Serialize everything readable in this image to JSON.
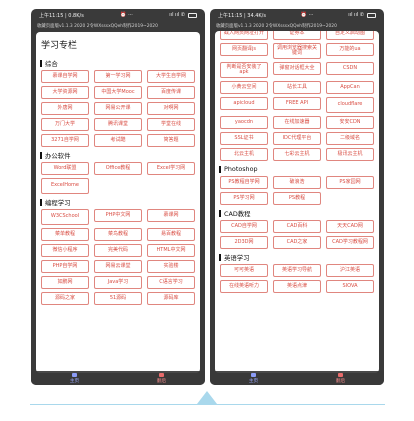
{
  "status": {
    "left": {
      "time_speed": "上午11:15 | 0.8K/s",
      "icons": "⏰ ···"
    },
    "right": {
      "time_speed": "上午11:15 | 34.4K/s",
      "icons": "⏰ ···"
    },
    "signal": "ııl ııl ✆"
  },
  "version_text": "收藏页面版v1.1.3 2020 2令WXsssxQQeh制作2019~2020",
  "left": {
    "card_title": "学习专栏",
    "sections": [
      {
        "title": "综合",
        "items": [
          "慕课自学网",
          "第一学习网",
          "大学生自学网",
          "大学资源网",
          "中国大学Mooc",
          "百度传课",
          "外唐网",
          "网易公开课",
          "对啊网",
          "万门大学",
          "腾讯课堂",
          "学堂在线",
          "3271自学网",
          "考试酷",
          "简答题"
        ]
      },
      {
        "title": "办公软件",
        "items": [
          "Word联盟",
          "Office教程",
          "Excel学习网",
          "ExcelHome"
        ]
      },
      {
        "title": "编程学习",
        "items": [
          "W3CSchool",
          "PHP中文网",
          "慕课网",
          "菜单教程",
          "菜鸟教程",
          "易百教程",
          "微信小程序",
          "完美代码",
          "HTML中文网",
          "PHP自学网",
          "网易云课堂",
          "实验楼",
          "如鹏网",
          "Java学习",
          "C语言学习",
          "源码之家",
          "51源码",
          "源码库"
        ]
      }
    ]
  },
  "right": {
    "top_rows": [
      [
        "截入网页网址打开",
        "证券本",
        "自定义启动图"
      ],
      [
        "网页翻译js",
        "调用浏览器搜索关键词",
        "万能的ua"
      ],
      [
        "判断是否安装了apk",
        "弹窗对话框大全",
        "CSDN"
      ],
      [
        "小黄云空间",
        "站长工具",
        "AppCan"
      ],
      [
        "apicloud",
        "FREE API",
        "cloudflare"
      ],
      [
        "yaocdn",
        "在线加速器",
        "安安CDN"
      ],
      [
        "SSL证书",
        "IDC代理平台",
        "二级域名"
      ],
      [
        "北云主机",
        "七彩云主机",
        "极讯云主机"
      ]
    ],
    "sections": [
      {
        "title": "Photoshop",
        "items": [
          "PS教程自学网",
          "破浪浩",
          "PS家园网",
          "PS学习网",
          "PS教程"
        ]
      },
      {
        "title": "CAD教程",
        "items": [
          "CAD自学网",
          "CAD百科",
          "天天CAD网",
          "2D3D网",
          "CAD之家",
          "CAD学习教程网"
        ]
      },
      {
        "title": "英语学习",
        "items": [
          "可可英语",
          "英语学习导航",
          "沪江英语",
          "在线英语听力",
          "英语点津",
          "SIOVA"
        ]
      }
    ]
  },
  "tabs": {
    "home": "主页",
    "other": "翻后"
  },
  "colors": {
    "accent": "#d94d43",
    "phone_frame": "#3a3a3a",
    "divider": "#a9d8ec"
  }
}
